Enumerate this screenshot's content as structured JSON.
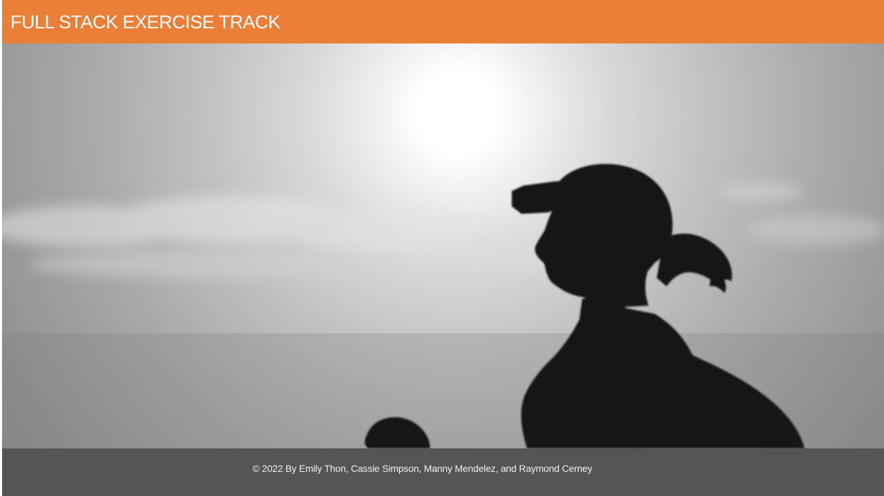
{
  "header": {
    "title": "FULL STACK EXERCISE TRACK",
    "background_color": "#ec7f37"
  },
  "hero": {
    "image_subject": "runner-silhouette-photo"
  },
  "footer": {
    "copyright": "© 2022 By Emily Thon, Cassie Simpson, Manny Mendelez, and Raymond Cerney",
    "background_color": "#555555"
  }
}
